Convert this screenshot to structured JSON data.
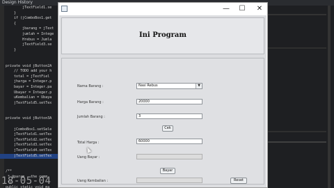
{
  "ide": {
    "menu_text": "Design  History",
    "code_lines": [
      "        jTextField1.se",
      "    }",
      "    if (jComboBox1.get",
      "    {",
      "        jbarang = jText",
      "        jumlah = Intege",
      "        Hrebus = Jumla",
      "        jTextField3.se",
      "    }",
      "",
      "",
      "private void jButton2A",
      "    // TODO add your h",
      "    total = jTextFiel",
      "    jharga = Integer.p",
      "    bayar = Integer.pa",
      "    Ubayar = Integer.p",
      "    uKembalian = Ubaya",
      "    jTextField5.setTex",
      "",
      "",
      "private void jButton3A",
      "",
      "    jComboBox1.setSele",
      "    jTextField1.setTex",
      "    jTextField2.setTex",
      "    jTextField3.setTex",
      "    jTextField4.setTex",
      "    jTextField5.setTex",
      "",
      "",
      "/**",
      " * @param   the comm",
      " */",
      "public static void ma"
    ],
    "watermark": "18-05-04"
  },
  "window": {
    "icon": "java-app-icon",
    "minimize": "—",
    "maximize": "☐",
    "close": "✕"
  },
  "header": {
    "title": "Ini Program"
  },
  "form": {
    "nama_barang_label": "Nama Barang :",
    "nama_barang_value": "Nasi Rebus",
    "harga_barang_label": "Harga Barang :",
    "harga_barang_value": "20000",
    "jumlah_barang_label": "Jumlah Barang :",
    "jumlah_barang_value": "3",
    "cek_button": "Cek",
    "total_harga_label": "Total Harga :",
    "total_harga_value": "60000",
    "uang_bayar_label": "Uang Bayar :",
    "uang_bayar_value": "",
    "bayar_button": "Bayar",
    "uang_kembalian_label": "Uang Kembalian :",
    "uang_kembalian_value": "",
    "reset_button": "Reset"
  }
}
